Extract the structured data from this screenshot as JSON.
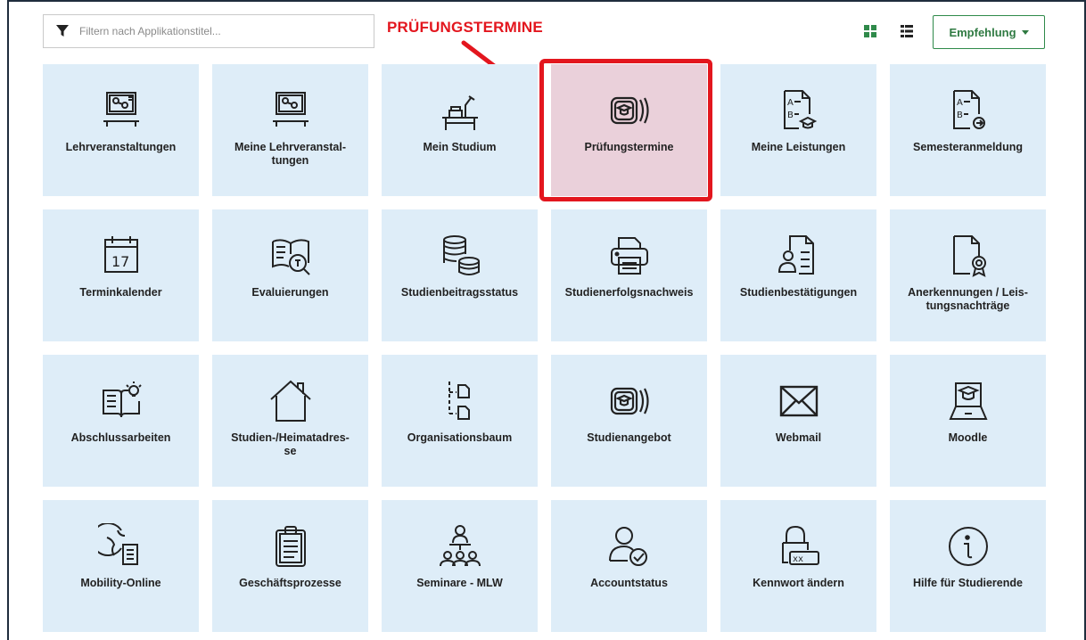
{
  "filter": {
    "placeholder": "Filtern nach Applikationstitel...",
    "icon": "filter-icon"
  },
  "callout": {
    "text": "PRÜFUNGSTERMINE",
    "color": "#e3161e"
  },
  "view_toggle": {
    "grid_icon": "grid-view-icon",
    "list_icon": "list-view-icon",
    "active_color": "#2f8a4a"
  },
  "sort_button": {
    "label": "Empfehlung"
  },
  "colors": {
    "tile_bg": "#deedf8",
    "highlight_tile_bg": "#ead0da",
    "highlight_border": "#e3161e"
  },
  "tiles": [
    {
      "label": "Lehrveranstaltungen",
      "icon": "lecture-board-icon"
    },
    {
      "label": "Meine Lehrveranstal-\ntungen",
      "icon": "lecture-board-icon"
    },
    {
      "label": "Mein Studium",
      "icon": "study-desk-icon"
    },
    {
      "label": "Prüfungstermine",
      "icon": "exam-card-icon"
    },
    {
      "label": "Meine Leistungen",
      "icon": "grades-document-icon"
    },
    {
      "label": "Semesteranmeldung",
      "icon": "semester-register-icon"
    },
    {
      "label": "Terminkalender",
      "icon": "calendar-icon",
      "day": "17"
    },
    {
      "label": "Evaluierungen",
      "icon": "evaluation-book-icon"
    },
    {
      "label": "Studienbeitragsstatus",
      "icon": "coin-stack-icon"
    },
    {
      "label": "Studienerfolgsnachweis",
      "icon": "printer-icon"
    },
    {
      "label": "Studienbestätigungen",
      "icon": "certificate-person-icon"
    },
    {
      "label": "Anerkennungen / Leis-\ntungsnachträge",
      "icon": "award-document-icon"
    },
    {
      "label": "Abschlussarbeiten",
      "icon": "thesis-book-icon"
    },
    {
      "label": "Studien-/Heimatadres-\nse",
      "icon": "house-icon"
    },
    {
      "label": "Organisationsbaum",
      "icon": "org-tree-icon"
    },
    {
      "label": "Studienangebot",
      "icon": "exam-card-icon"
    },
    {
      "label": "Webmail",
      "icon": "envelope-icon"
    },
    {
      "label": "Moodle",
      "icon": "laptop-graduate-icon"
    },
    {
      "label": "Mobility-Online",
      "icon": "globe-document-icon"
    },
    {
      "label": "Geschäftsprozesse",
      "icon": "clipboard-icon"
    },
    {
      "label": "Seminare - MLW",
      "icon": "seminar-group-icon"
    },
    {
      "label": "Accountstatus",
      "icon": "user-check-icon"
    },
    {
      "label": "Kennwort ändern",
      "icon": "password-lock-icon",
      "mask": "xx_"
    },
    {
      "label": "Hilfe für Studierende",
      "icon": "info-circle-icon"
    }
  ]
}
